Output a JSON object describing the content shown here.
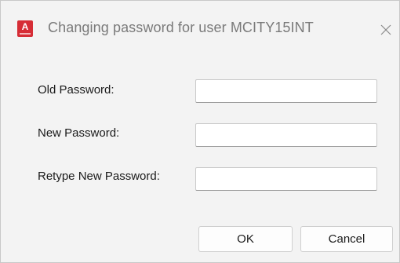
{
  "window": {
    "title": "Changing password for user MCITY15INT",
    "app_icon": "autodesk-a-icon",
    "app_icon_letter": "A",
    "close_icon": "close-icon"
  },
  "form": {
    "fields": [
      {
        "label": "Old Password:",
        "value": "",
        "type": "password"
      },
      {
        "label": "New Password:",
        "value": "",
        "type": "password"
      },
      {
        "label": "Retype New Password:",
        "value": "",
        "type": "password"
      }
    ]
  },
  "buttons": {
    "ok_label": "OK",
    "cancel_label": "Cancel"
  },
  "colors": {
    "dialog_background": "#f3f3f3",
    "app_icon_red": "#d62d36",
    "field_background": "#ffffff"
  }
}
